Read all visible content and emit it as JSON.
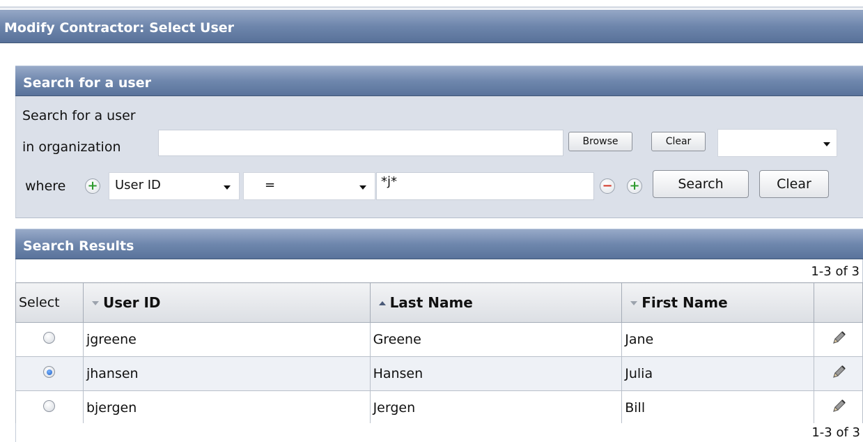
{
  "page": {
    "title": "Modify Contractor: Select User"
  },
  "search_panel": {
    "header": "Search for a user",
    "intro": "Search for a user",
    "org_label": "in organization",
    "org_value": "",
    "browse_label": "Browse",
    "clear_small_label": "Clear",
    "org_dropdown_value": "",
    "where_label": "where",
    "field_select": "User ID",
    "operator_select": "=",
    "criteria_value": "*j*",
    "search_label": "Search",
    "clear_label": "Clear"
  },
  "results": {
    "header": "Search Results",
    "pager_top": "1-3 of 3",
    "pager_bottom": "1-3 of 3",
    "columns": {
      "select": "Select",
      "user_id": "User ID",
      "last_name": "Last Name",
      "first_name": "First Name"
    },
    "rows": [
      {
        "user_id": "jgreene",
        "last_name": "Greene",
        "first_name": "Jane",
        "selected": false
      },
      {
        "user_id": "jhansen",
        "last_name": "Hansen",
        "first_name": "Julia",
        "selected": true
      },
      {
        "user_id": "bjergen",
        "last_name": "Jergen",
        "first_name": "Bill",
        "selected": false
      }
    ]
  },
  "icons": {
    "add_condition": "plus-circle-icon",
    "remove_condition": "minus-circle-icon",
    "edit": "pencil-icon",
    "dropdown": "chevron-down-icon"
  },
  "colors": {
    "header_blue": "#6e86ac",
    "panel_gray": "#dbe0e9",
    "plus_green": "#2e9a2e",
    "minus_red": "#d23a2a",
    "alt_row": "#eef1f6"
  }
}
